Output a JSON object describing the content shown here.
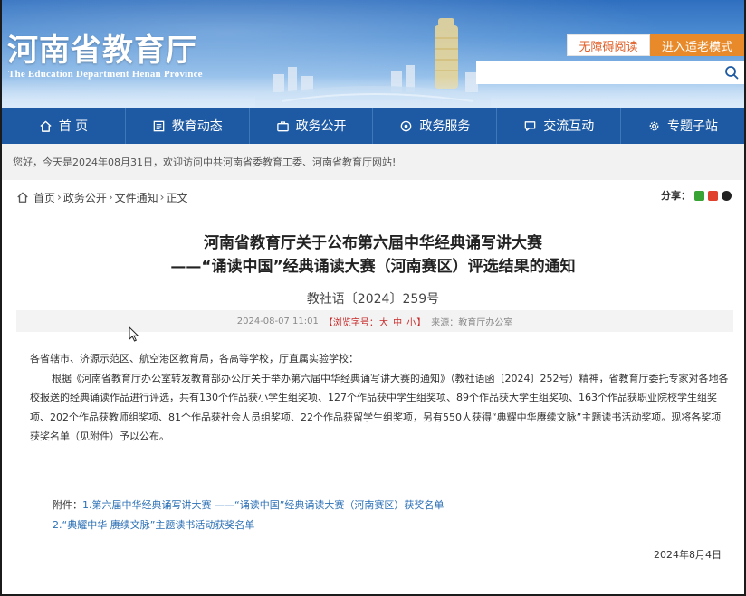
{
  "header": {
    "logo_cn": "河南省教育厅",
    "logo_en": "The Education Department Henan Province",
    "accessibility_label": "无障碍阅读",
    "elder_mode_label": "进入适老模式",
    "search_placeholder": ""
  },
  "nav": {
    "items": [
      {
        "label": "首 页",
        "icon": "home-icon"
      },
      {
        "label": "教育动态",
        "icon": "newspaper-icon"
      },
      {
        "label": "政务公开",
        "icon": "briefcase-icon"
      },
      {
        "label": "政务服务",
        "icon": "service-icon"
      },
      {
        "label": "交流互动",
        "icon": "chat-icon"
      },
      {
        "label": "专题子站",
        "icon": "gear-icon"
      }
    ]
  },
  "welcome": "您好，今天是2024年08月31日，欢迎访问中共河南省委教育工委、河南省教育厅网站!",
  "breadcrumb": {
    "items": [
      "首页",
      "政务公开",
      "文件通知"
    ],
    "current": "正文",
    "separator": "›"
  },
  "share": {
    "label": "分享："
  },
  "article": {
    "title_line1": "河南省教育厅关于公布第六届中华经典诵写讲大赛",
    "title_line2": "——“诵读中国”经典诵读大赛（河南赛区）评选结果的通知",
    "doc_number": "教社语〔2024〕259号",
    "meta": {
      "date": "2024-08-07 11:01",
      "font_size_prefix": "【浏览字号：",
      "font_size_options": [
        "大",
        "中",
        "小"
      ],
      "font_size_suffix": "】",
      "source": "来源：教育厅办公室"
    },
    "addressee": "各省辖市、济源示范区、航空港区教育局，各高等学校，厅直属实验学校：",
    "paragraph": "根据《河南省教育厅办公室转发教育部办公厅关于举办第六届中华经典诵写讲大赛的通知》（教社语函〔2024〕252号）精神，省教育厅委托专家对各地各校报送的经典诵读作品进行评选，共有130个作品获小学生组奖项、127个作品获中学生组奖项、89个作品获大学生组奖项、163个作品获职业院校学生组奖项、202个作品获教师组奖项、81个作品获社会人员组奖项、22个作品获留学生组奖项，另有550人获得“典耀中华赓续文脉”主题读书活动奖项。现将各奖项获奖名单（见附件）予以公布。",
    "attachments_label": "附件：",
    "attachments": [
      "1.第六届中华经典诵写讲大赛 ——“诵读中国”经典诵读大赛（河南赛区）获奖名单",
      "2.“典耀中华 赓续文脉”主题读书活动获奖名单"
    ],
    "date_signed": "2024年8月4日"
  },
  "colors": {
    "nav_bg": "#1d5aa3",
    "elder_btn": "#e88a2a",
    "accessibility_text": "#e0612b",
    "link": "#2a6fb5",
    "font_size_red": "#c62828"
  }
}
